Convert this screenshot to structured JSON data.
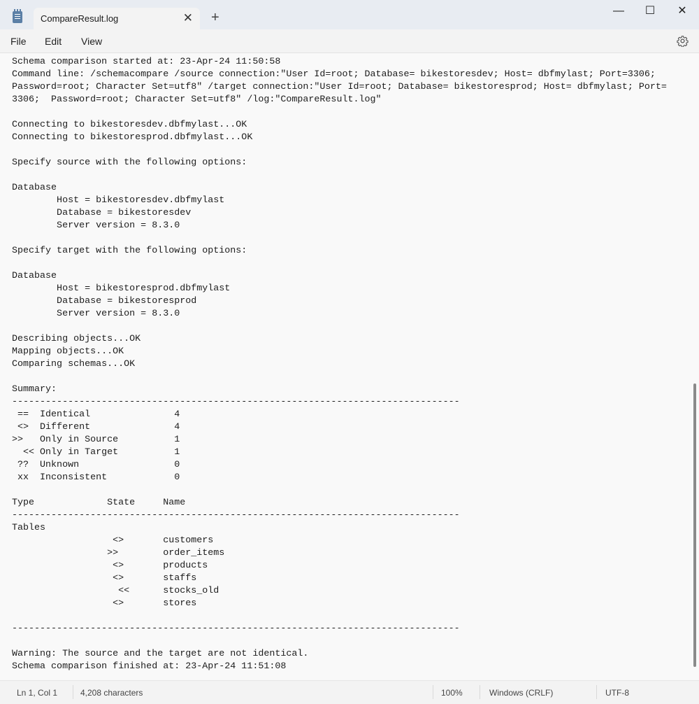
{
  "window": {
    "tab_title": "CompareResult.log",
    "close_tab_glyph": "✕",
    "new_tab_glyph": "+",
    "minimize_glyph": "—",
    "maximize_glyph": "☐",
    "close_glyph": "✕"
  },
  "menu": {
    "file": "File",
    "edit": "Edit",
    "view": "View",
    "settings_icon": "gear-icon"
  },
  "editor": {
    "lines": [
      "Schema comparison started at: 23-Apr-24 11:50:58",
      "Command line: /schemacompare /source connection:\"User Id=root; Database= bikestoresdev; Host= dbfmylast; Port=3306;",
      "Password=root; Character Set=utf8\" /target connection:\"User Id=root; Database= bikestoresprod; Host= dbfmylast; Port=",
      "3306;  Password=root; Character Set=utf8\" /log:\"CompareResult.log\"",
      "",
      "Connecting to bikestoresdev.dbfmylast...OK",
      "Connecting to bikestoresprod.dbfmylast...OK",
      "",
      "Specify source with the following options:",
      "",
      "Database",
      "        Host = bikestoresdev.dbfmylast",
      "        Database = bikestoresdev",
      "        Server version = 8.3.0",
      "",
      "Specify target with the following options:",
      "",
      "Database",
      "        Host = bikestoresprod.dbfmylast",
      "        Database = bikestoresprod",
      "        Server version = 8.3.0",
      "",
      "Describing objects...OK",
      "Mapping objects...OK",
      "Comparing schemas...OK",
      "",
      "Summary:",
      "--------------------------------------------------------------------------------",
      " ==  Identical               4",
      " <>  Different               4",
      ">>   Only in Source          1",
      "  << Only in Target          1",
      " ??  Unknown                 0",
      " xx  Inconsistent            0",
      "",
      "Type             State     Name",
      "--------------------------------------------------------------------------------",
      "Tables",
      "                  <>       customers",
      "                 >>        order_items",
      "                  <>       products",
      "                  <>       staffs",
      "                   <<      stocks_old",
      "                  <>       stores",
      "",
      "--------------------------------------------------------------------------------",
      "",
      "Warning: The source and the target are not identical.",
      "Schema comparison finished at: 23-Apr-24 11:51:08"
    ]
  },
  "status": {
    "position": "Ln 1, Col 1",
    "characters": "4,208 characters",
    "zoom": "100%",
    "line_endings": "Windows (CRLF)",
    "encoding": "UTF-8"
  }
}
